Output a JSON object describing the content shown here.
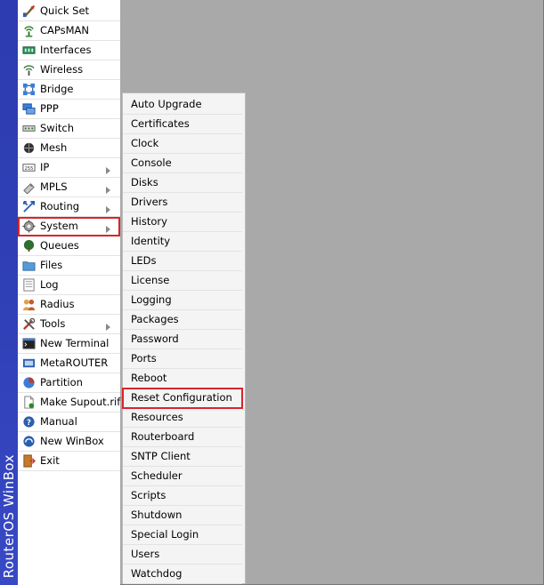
{
  "app": {
    "brand": "RouterOS WinBox"
  },
  "main_menu": {
    "items": [
      {
        "label": "Quick Set",
        "icon": "quick-set-icon"
      },
      {
        "label": "CAPsMAN",
        "icon": "capsman-icon"
      },
      {
        "label": "Interfaces",
        "icon": "interfaces-icon"
      },
      {
        "label": "Wireless",
        "icon": "wireless-icon"
      },
      {
        "label": "Bridge",
        "icon": "bridge-icon"
      },
      {
        "label": "PPP",
        "icon": "ppp-icon"
      },
      {
        "label": "Switch",
        "icon": "switch-icon"
      },
      {
        "label": "Mesh",
        "icon": "mesh-icon"
      },
      {
        "label": "IP",
        "icon": "ip-icon",
        "submenu": true
      },
      {
        "label": "MPLS",
        "icon": "mpls-icon",
        "submenu": true
      },
      {
        "label": "Routing",
        "icon": "routing-icon",
        "submenu": true
      },
      {
        "label": "System",
        "icon": "system-gear-icon",
        "submenu": true,
        "selected": true
      },
      {
        "label": "Queues",
        "icon": "queues-icon"
      },
      {
        "label": "Files",
        "icon": "files-icon"
      },
      {
        "label": "Log",
        "icon": "log-icon"
      },
      {
        "label": "Radius",
        "icon": "radius-icon"
      },
      {
        "label": "Tools",
        "icon": "tools-icon",
        "submenu": true
      },
      {
        "label": "New Terminal",
        "icon": "terminal-icon"
      },
      {
        "label": "MetaROUTER",
        "icon": "metarouter-icon"
      },
      {
        "label": "Partition",
        "icon": "partition-icon"
      },
      {
        "label": "Make Supout.rif",
        "icon": "supout-icon"
      },
      {
        "label": "Manual",
        "icon": "manual-icon"
      },
      {
        "label": "New WinBox",
        "icon": "new-winbox-icon"
      },
      {
        "label": "Exit",
        "icon": "exit-icon"
      }
    ]
  },
  "system_submenu": {
    "items": [
      {
        "label": "Auto Upgrade"
      },
      {
        "label": "Certificates"
      },
      {
        "label": "Clock"
      },
      {
        "label": "Console"
      },
      {
        "label": "Disks"
      },
      {
        "label": "Drivers"
      },
      {
        "label": "History"
      },
      {
        "label": "Identity"
      },
      {
        "label": "LEDs"
      },
      {
        "label": "License"
      },
      {
        "label": "Logging"
      },
      {
        "label": "Packages"
      },
      {
        "label": "Password"
      },
      {
        "label": "Ports"
      },
      {
        "label": "Reboot"
      },
      {
        "label": "Reset Configuration",
        "selected": true
      },
      {
        "label": "Resources"
      },
      {
        "label": "Routerboard"
      },
      {
        "label": "SNTP Client"
      },
      {
        "label": "Scheduler"
      },
      {
        "label": "Scripts"
      },
      {
        "label": "Shutdown"
      },
      {
        "label": "Special Login"
      },
      {
        "label": "Users"
      },
      {
        "label": "Watchdog"
      }
    ]
  },
  "colors": {
    "brand_strip": "#2f3fb6",
    "selection_outline": "#d9252a",
    "workspace": "#a9a9a9"
  }
}
